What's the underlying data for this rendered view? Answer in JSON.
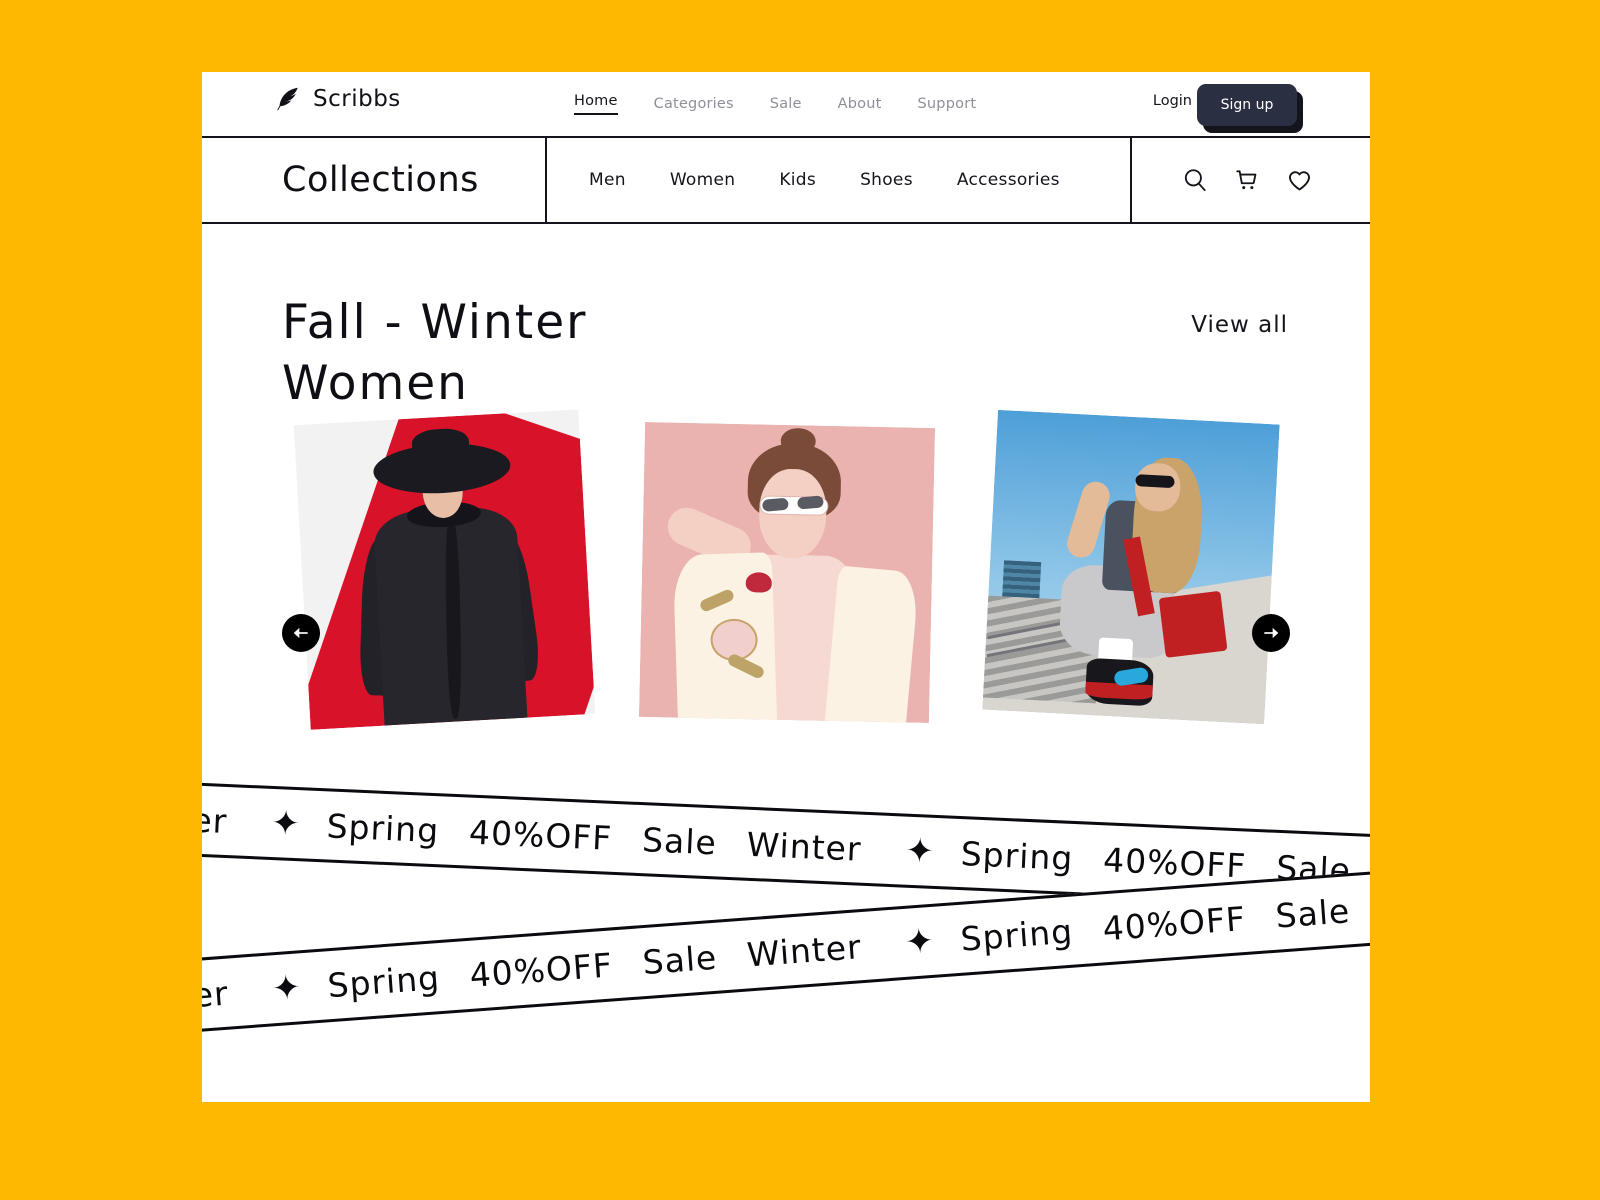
{
  "theme": {
    "background": "#FDB900",
    "page_background": "#FFFFFF",
    "ink": "#14141C",
    "muted": "#8F8F99",
    "signup_button": "#2B2F42"
  },
  "header": {
    "brand": {
      "name": "Scribbs",
      "icon": "feather-quill-icon"
    },
    "nav_links": [
      {
        "label": "Home",
        "active": true
      },
      {
        "label": "Categories",
        "active": false
      },
      {
        "label": "Sale",
        "active": false
      },
      {
        "label": "About",
        "active": false
      },
      {
        "label": "Support",
        "active": false
      }
    ],
    "login_label": "Login",
    "signup_label": "Sign up"
  },
  "collections_bar": {
    "title": "Collections",
    "categories": [
      {
        "label": "Men"
      },
      {
        "label": "Women"
      },
      {
        "label": "Kids"
      },
      {
        "label": "Shoes"
      },
      {
        "label": "Accessories"
      }
    ],
    "icons": [
      {
        "name": "search-icon"
      },
      {
        "name": "cart-icon"
      },
      {
        "name": "heart-icon"
      }
    ]
  },
  "hero": {
    "title": "Fall - Winter\nWomen",
    "view_all_label": "View all"
  },
  "carousel": {
    "prev_label": "←",
    "next_label": "→",
    "slides": [
      {
        "alt": "Woman in black ruffled coat and wide-brim hat on red and white background"
      },
      {
        "alt": "Woman in cream embroidered floral jacket and sunglasses on pink background"
      },
      {
        "alt": "Woman in grey sweatpants with red shoulder bag seated on concrete steps"
      }
    ]
  },
  "marquee": {
    "star_glyph": "✦",
    "bands": [
      {
        "items": [
          "Winter",
          "✦",
          "Spring",
          "40%OFF",
          "Sale",
          "Winter",
          "✦",
          "Spring",
          "40%OFF",
          "Sale"
        ]
      },
      {
        "items": [
          "Winter",
          "✦",
          "Spring",
          "40%OFF",
          "Sale",
          "Winter",
          "✦",
          "Spring",
          "40%OFF",
          "Sale"
        ]
      }
    ]
  }
}
